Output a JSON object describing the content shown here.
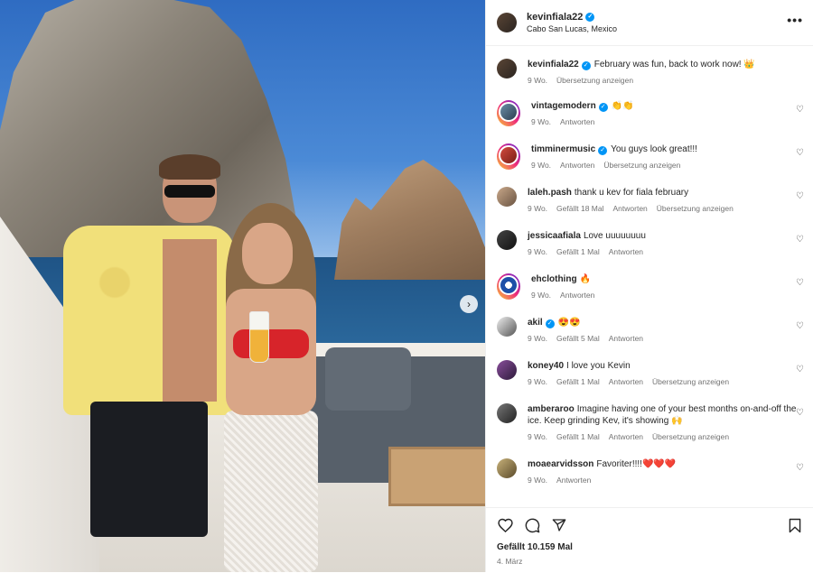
{
  "post": {
    "username": "kevinfiala22",
    "location": "Cabo San Lucas, Mexico",
    "more_label": "•••",
    "caption": {
      "username": "kevinfiala22",
      "text": "February was fun, back to work now! 👑",
      "time": "9 Wo.",
      "translate": "Übersetzung anzeigen"
    }
  },
  "comments": [
    {
      "username": "vintagemodern",
      "verified": true,
      "text": "👏👏",
      "time": "9 Wo.",
      "likes": "",
      "reply": "Antworten",
      "translate": ""
    },
    {
      "username": "timminermusic",
      "verified": true,
      "text": "You guys look great!!!",
      "time": "9 Wo.",
      "likes": "",
      "reply": "Antworten",
      "translate": "Übersetzung anzeigen"
    },
    {
      "username": "laleh.pash",
      "verified": false,
      "text": "thank u kev for fiala february",
      "time": "9 Wo.",
      "likes": "Gefällt 18 Mal",
      "reply": "Antworten",
      "translate": "Übersetzung anzeigen"
    },
    {
      "username": "jessicaafiala",
      "verified": false,
      "text": "Love uuuuuuuu",
      "time": "9 Wo.",
      "likes": "Gefällt 1 Mal",
      "reply": "Antworten",
      "translate": ""
    },
    {
      "username": "ehclothing",
      "verified": false,
      "text": "🔥",
      "time": "9 Wo.",
      "likes": "",
      "reply": "Antworten",
      "translate": ""
    },
    {
      "username": "akil",
      "verified": true,
      "text": "😍😍",
      "time": "9 Wo.",
      "likes": "Gefällt 5 Mal",
      "reply": "Antworten",
      "translate": ""
    },
    {
      "username": "koney40",
      "verified": false,
      "text": "I love you Kevin",
      "time": "9 Wo.",
      "likes": "Gefällt 1 Mal",
      "reply": "Antworten",
      "translate": "Übersetzung anzeigen"
    },
    {
      "username": "amberaroo",
      "verified": false,
      "text": "Imagine having one of your best months on-and-off the ice. Keep grinding Kev, it's showing 🙌",
      "time": "9 Wo.",
      "likes": "Gefällt 1 Mal",
      "reply": "Antworten",
      "translate": "Übersetzung anzeigen"
    },
    {
      "username": "moaearvidsson",
      "verified": false,
      "text": "Favoriter!!!!❤️❤️❤️",
      "time": "9 Wo.",
      "likes": "",
      "reply": "Antworten",
      "translate": ""
    }
  ],
  "footer": {
    "likes": "Gefällt 10.159 Mal",
    "date": "4. März"
  },
  "icons": {
    "verified": "✓",
    "heart": "♡",
    "carousel_next": "›"
  },
  "colors": {
    "verified_blue": "#0095f6",
    "meta_gray": "#737373",
    "text": "#262626"
  }
}
